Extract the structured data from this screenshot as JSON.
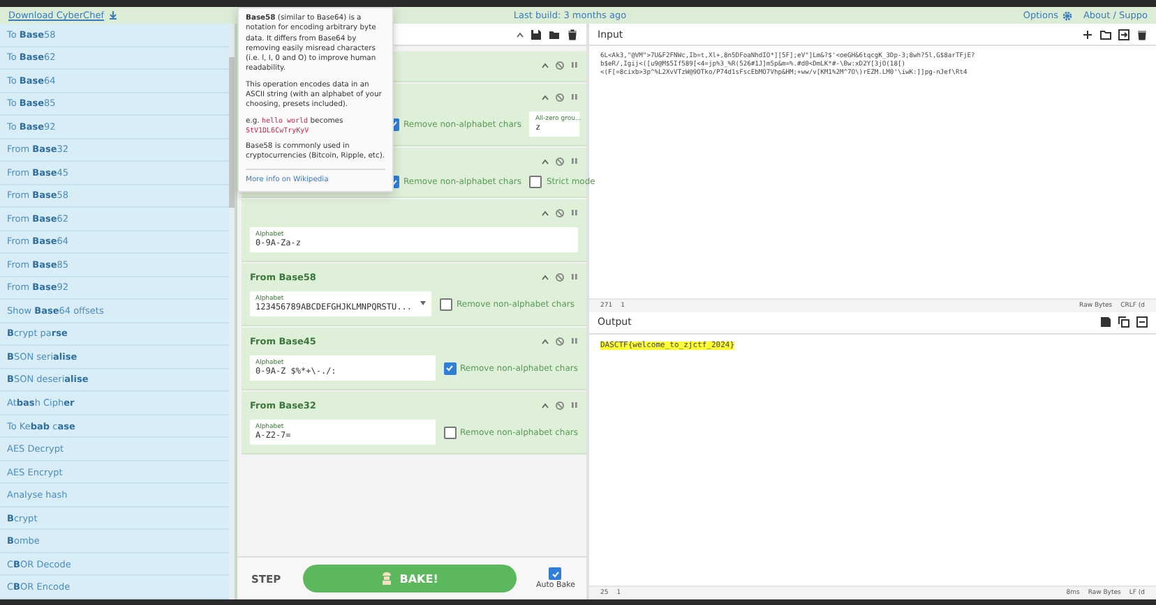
{
  "top_bar": {
    "download": "Download CyberChef",
    "build": "Last build: 3 months ago",
    "options": "Options",
    "about": "About / Suppo"
  },
  "operations": [
    "To **Base**58",
    "To **Base**62",
    "To **Base**64",
    "To **Base**85",
    "To **Base**92",
    "From **Base**32",
    "From **Base**45",
    "From **Base**58",
    "From **Base**62",
    "From **Base**64",
    "From **Base**85",
    "From **Base**92",
    "Show **Base**64 offsets",
    "**B**crypt pa**rse**",
    "**B**SON seri**alise**",
    "**B**SON deseri**alise**",
    "At**bas**h Ciph**er**",
    "To Ke**bab** c**ase**",
    "AES Decrypt",
    "AES Encrypt",
    "Analyse hash",
    "**B**crypt",
    "**B**ombe",
    "C**B**OR Decode",
    "C**B**OR Encode"
  ],
  "recipe": {
    "ingredients": [
      {
        "paused": false
      },
      {
        "args": [
          {
            "kind": "checkbox",
            "label": "Remove non-alphabet chars",
            "checked": true
          },
          {
            "kind": "field",
            "label": "All-zero grou...",
            "value": "z"
          }
        ]
      },
      {
        "args": [
          {
            "kind": "checkbox",
            "label": "Remove non-alphabet chars",
            "checked": true
          },
          {
            "kind": "checkbox",
            "label": "Strict mode",
            "checked": false
          }
        ]
      },
      {
        "args": [
          {
            "kind": "field",
            "label": "Alphabet",
            "value": "0-9A-Za-z"
          }
        ]
      },
      {
        "title": "From Base58",
        "args": [
          {
            "kind": "select",
            "label": "Alphabet",
            "value": "123456789ABCDEFGHJKLMNPQRSTU..."
          },
          {
            "kind": "checkbox",
            "label": "Remove non-alphabet chars",
            "checked": false
          }
        ]
      },
      {
        "title": "From Base45",
        "args": [
          {
            "kind": "field",
            "label": "Alphabet",
            "value": "0-9A-Z $%*+\\-./:"
          },
          {
            "kind": "checkbox",
            "label": "Remove non-alphabet chars",
            "checked": true
          }
        ]
      },
      {
        "title": "From Base32",
        "args": [
          {
            "kind": "field",
            "label": "Alphabet",
            "value": "A-Z2-7="
          },
          {
            "kind": "checkbox",
            "label": "Remove non-alphabet chars",
            "checked": false
          }
        ]
      }
    ]
  },
  "tooltip": {
    "paragraphs": [
      "**Base58** (similar to Base64) is a notation for encoding arbitrary byte data. It differs from Base64 by removing easily misread characters (i.e. l, I, 0 and O) to improve human readability.",
      "This operation encodes data in an ASCII string (with an alphabet of your choosing, presets included).",
      "Base58 is commonly used in cryptocurrencies (Bitcoin, Ripple, etc)."
    ],
    "example_prefix": "e.g.",
    "example_input": "hello world",
    "example_mid": "becomes",
    "example_output": "StV1DL6CwTryKyV",
    "link": "More info on Wikipedia"
  },
  "bake": {
    "step": "STEP",
    "bake": "BAKE!",
    "auto_bake": {
      "label": "Auto Bake",
      "checked": true
    }
  },
  "input": {
    "title": "Input",
    "lines": [
      "6L<Ak3,\"@VM\">7U&F2FNWc,Ib=t,Xl+,8n5DFoaNhdIO*][5F];eV\"]Lm&?$'<oeGH&6tqcgK_3Dp-3;8wh?5l,G$8arTFjE?",
      "b$eR/,Igij<([u9@M$5If589[<4=jp%3_%R(526#1J]m5p&m=%.#d0<DmLK*#-\\Bw:xD2Y[3jO(18[)",
      "<(F[=8cixb>3p^%L2XvVTzW@9OTko/P74d1sFscEbMO7Vhp&HM;+ww/v[KM1%2M^7O\\)rEZM.LM0'\\iwK:]]pg-nJef\\Rt4"
    ],
    "status": {
      "length": "271",
      "lines": "1",
      "format": "Raw Bytes",
      "eol": "CRLF (d"
    }
  },
  "output": {
    "title": "Output",
    "text": "DASCTF{welcome_to_zjctf_2024}",
    "status": {
      "length": "25",
      "lines": "1",
      "time": "8ms",
      "format": "Raw Bytes",
      "eol": "LF (d"
    }
  }
}
